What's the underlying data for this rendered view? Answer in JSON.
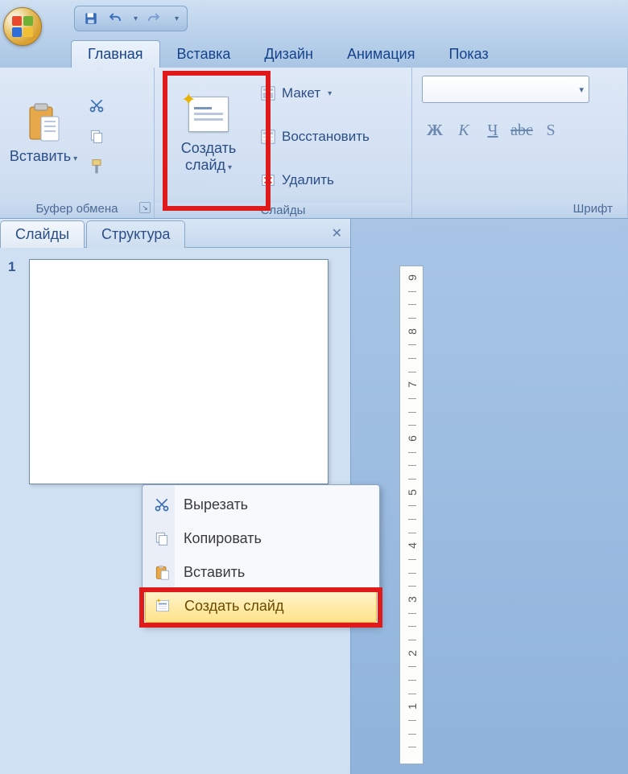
{
  "tabs": {
    "home": "Главная",
    "insert": "Вставка",
    "design": "Дизайн",
    "animation": "Анимация",
    "slideshow": "Показ"
  },
  "ribbon": {
    "clipboard": {
      "paste": "Вставить",
      "group_label": "Буфер обмена"
    },
    "slides": {
      "new_slide": "Создать\nслайд",
      "layout": "Макет",
      "reset": "Восстановить",
      "delete": "Удалить",
      "group_label": "Слайды"
    },
    "font": {
      "group_label": "Шрифт",
      "bold": "Ж",
      "italic": "К",
      "underline": "Ч",
      "strike": "abc",
      "shadow": "S"
    }
  },
  "panel": {
    "tab_slides": "Слайды",
    "tab_outline": "Структура",
    "slide_number": "1"
  },
  "context_menu": {
    "cut": "Вырезать",
    "copy": "Копировать",
    "paste": "Вставить",
    "new_slide": "Создать слайд"
  },
  "ruler_numbers": [
    "9",
    "8",
    "7",
    "6",
    "5",
    "4",
    "3",
    "2",
    "1"
  ]
}
